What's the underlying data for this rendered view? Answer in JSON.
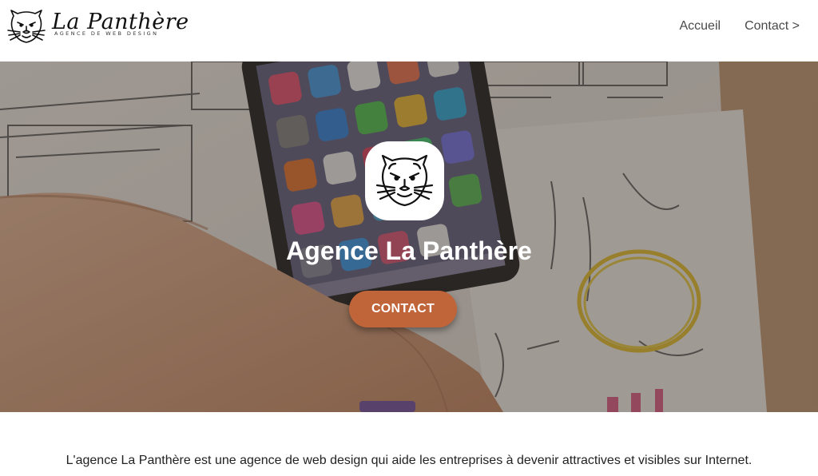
{
  "header": {
    "brand_title": "La Panthère",
    "brand_subtitle": "AGENCE DE WEB DESIGN",
    "logo_icon": "panther-head-icon",
    "nav": [
      {
        "label": "Accueil"
      },
      {
        "label": "Contact >"
      }
    ]
  },
  "hero": {
    "background": "smartphone-and-wireframe-sketches-photo",
    "logo_icon": "panther-head-icon",
    "title": "Agence La Panthère",
    "cta_label": "Contact"
  },
  "content": {
    "intro": "L'agence La Panthère est une agence de web design qui aide les entreprises à devenir attractives et visibles sur Internet."
  },
  "colors": {
    "cta": "#c0643a",
    "header_bg": "#ffffff",
    "nav_text": "#4a4a4a"
  }
}
